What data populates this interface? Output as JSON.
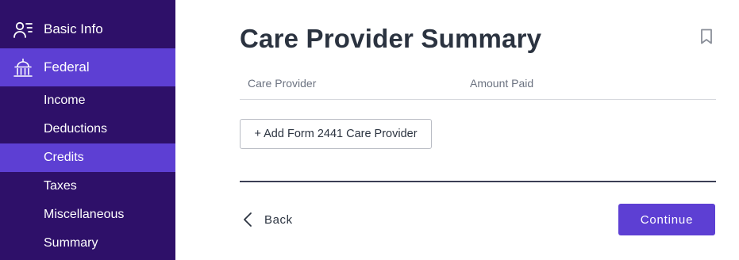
{
  "sidebar": {
    "basic_info": {
      "label": "Basic Info",
      "icon": "person-list-icon"
    },
    "federal": {
      "label": "Federal",
      "icon": "capitol-building-icon"
    },
    "sub_items": [
      {
        "label": "Income"
      },
      {
        "label": "Deductions"
      },
      {
        "label": "Credits"
      },
      {
        "label": "Taxes"
      },
      {
        "label": "Miscellaneous"
      },
      {
        "label": "Summary"
      }
    ],
    "active_sub_item": "Credits",
    "colors": {
      "background": "#2e1069",
      "active": "#5d3fd3"
    }
  },
  "main": {
    "title": "Care Provider Summary",
    "bookmark_icon": "bookmark-icon",
    "table": {
      "columns": [
        "Care Provider",
        "Amount Paid"
      ],
      "rows": []
    },
    "add_button_label": "+ Add Form 2441 Care Provider",
    "back_label": "Back",
    "continue_label": "Continue",
    "accent_color": "#5d3fd3"
  }
}
